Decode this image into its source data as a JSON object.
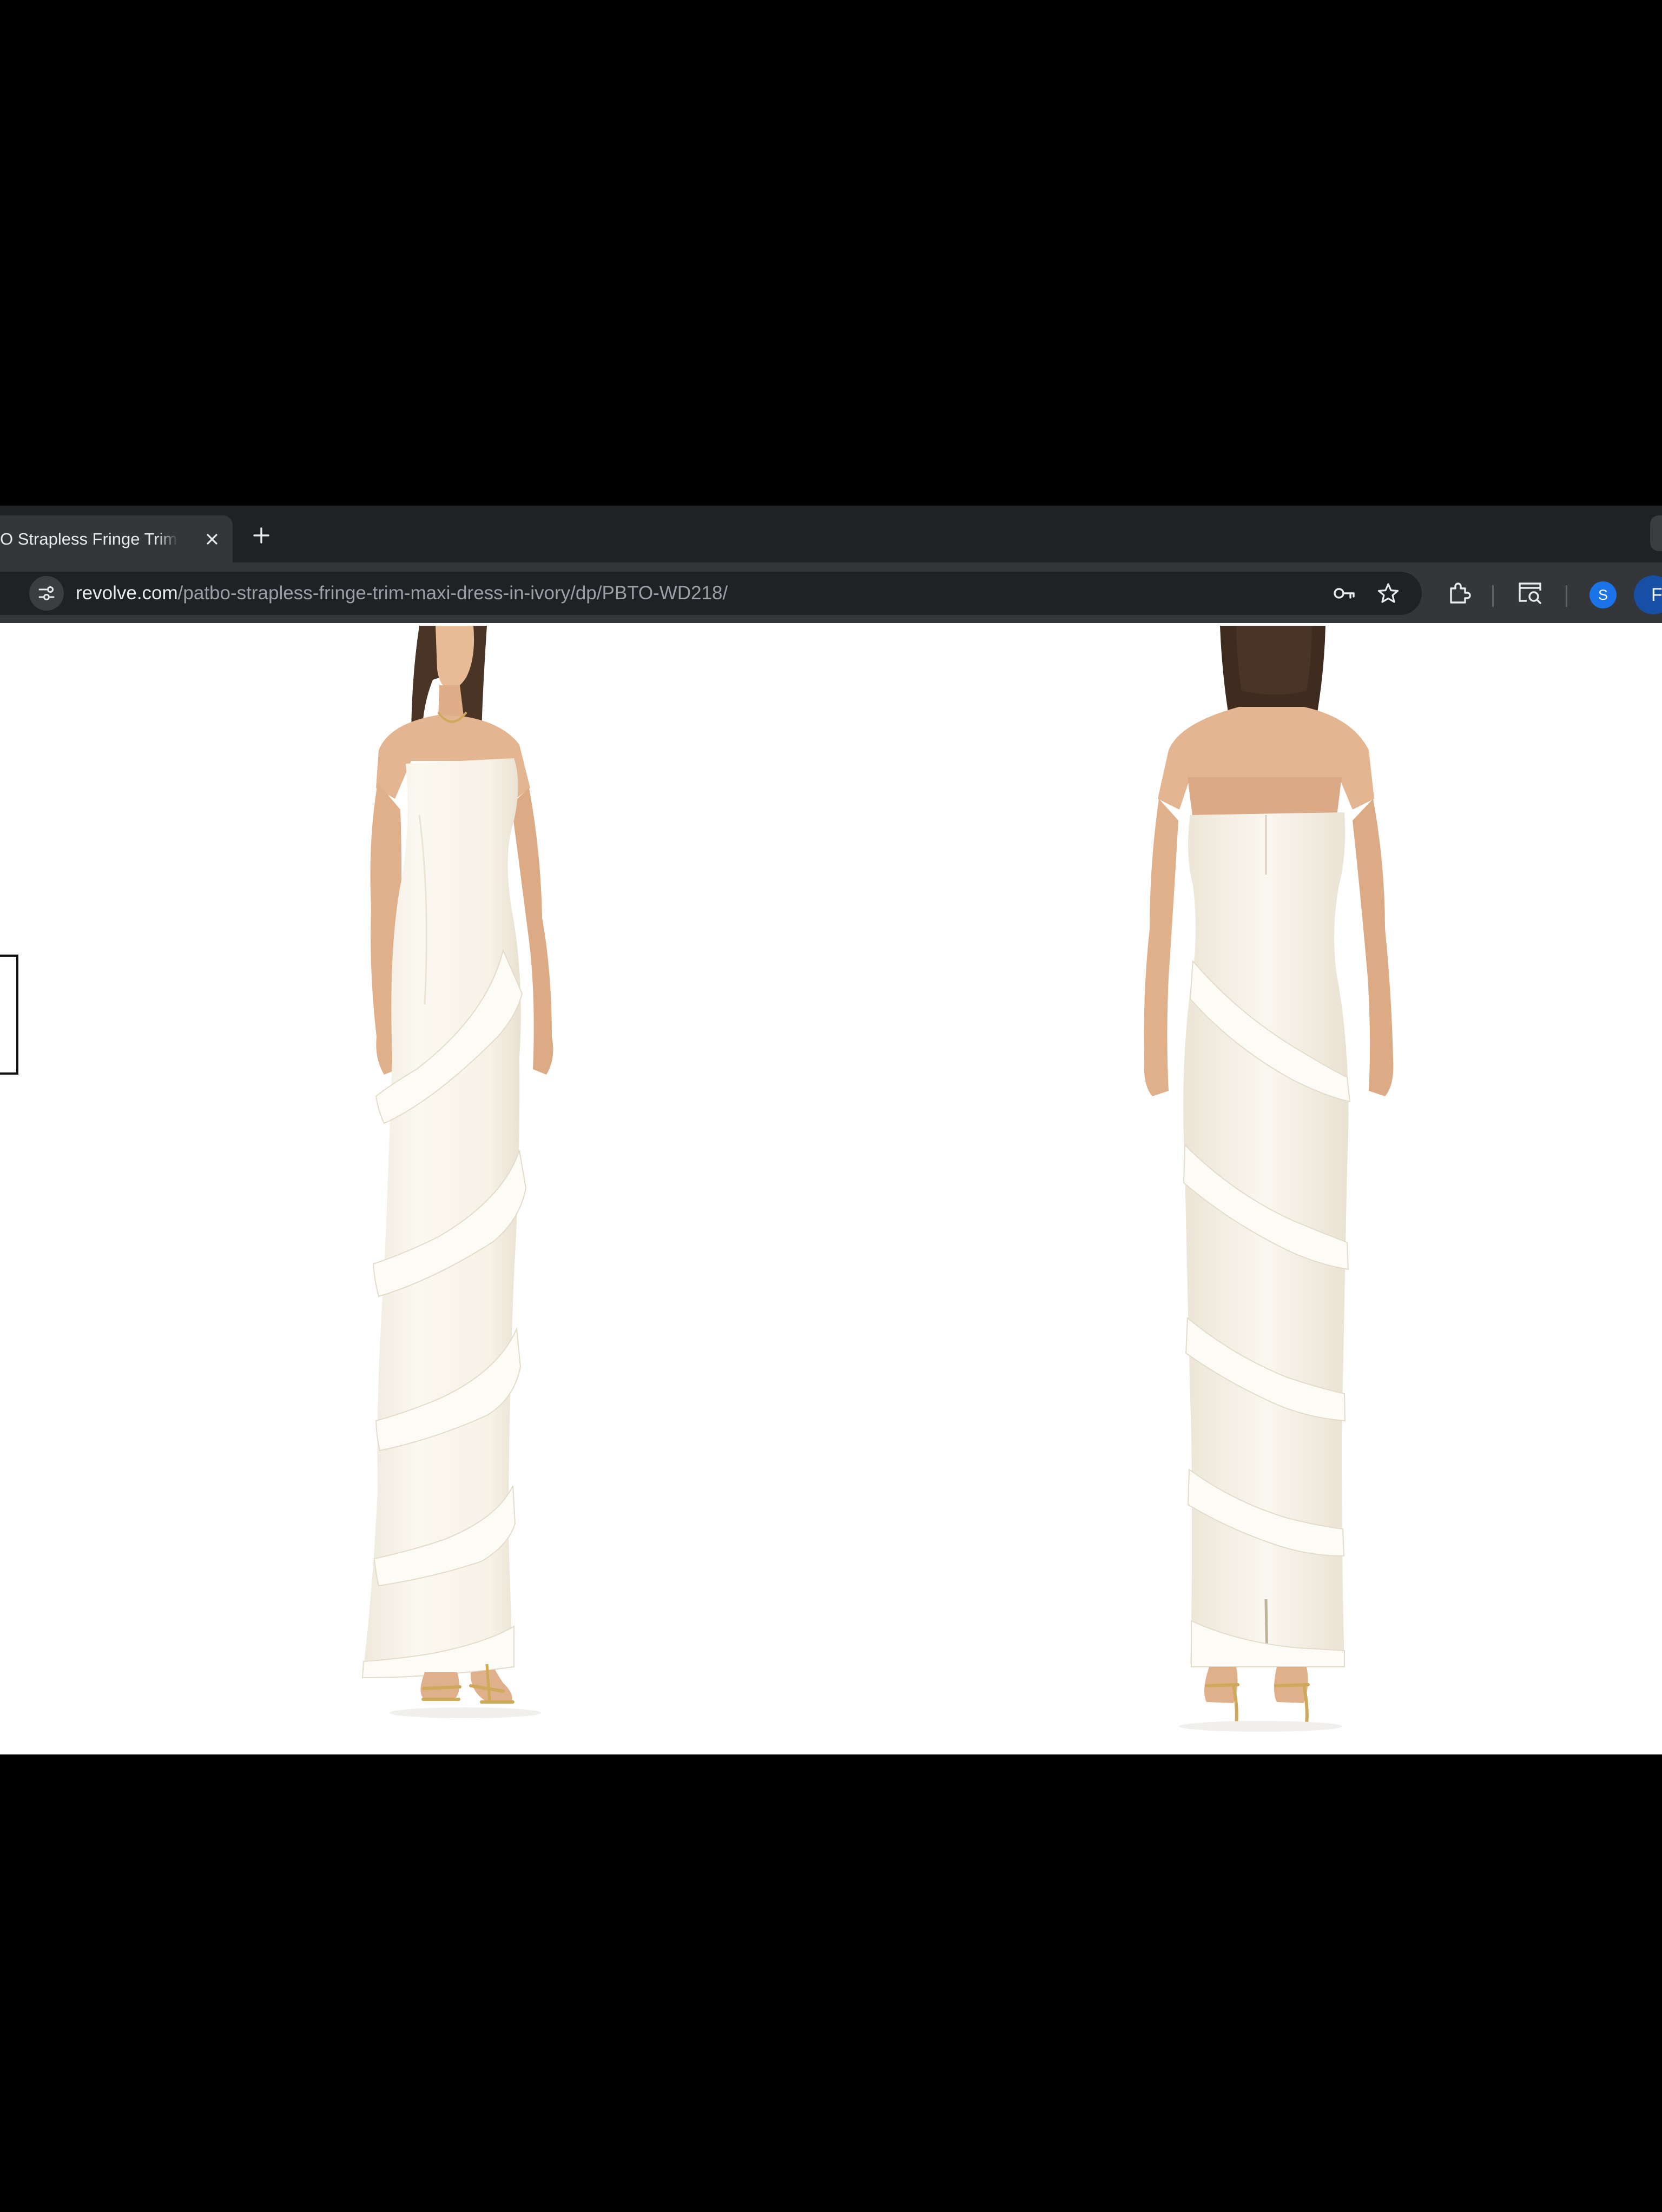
{
  "browser": {
    "tab": {
      "title": "O Strapless Fringe Trim Maxi"
    },
    "url": {
      "host": "revolve.com",
      "path": "/patbo-strapless-fringe-trim-maxi-dress-in-ivory/dp/PBTO-WD218/"
    },
    "profile_initial": "S",
    "profile2_initial": "F"
  },
  "icons": [
    "close-icon",
    "plus-icon",
    "site-info-icon",
    "password-key-icon",
    "star-icon",
    "extensions-icon",
    "tab-search-icon"
  ],
  "colors": {
    "chrome_dark": "#202124",
    "chrome_toolbar": "#35363a",
    "dress": "#f7f3ea",
    "skin": "#e3b591",
    "hair": "#4a3426",
    "gold": "#cfa85a"
  }
}
